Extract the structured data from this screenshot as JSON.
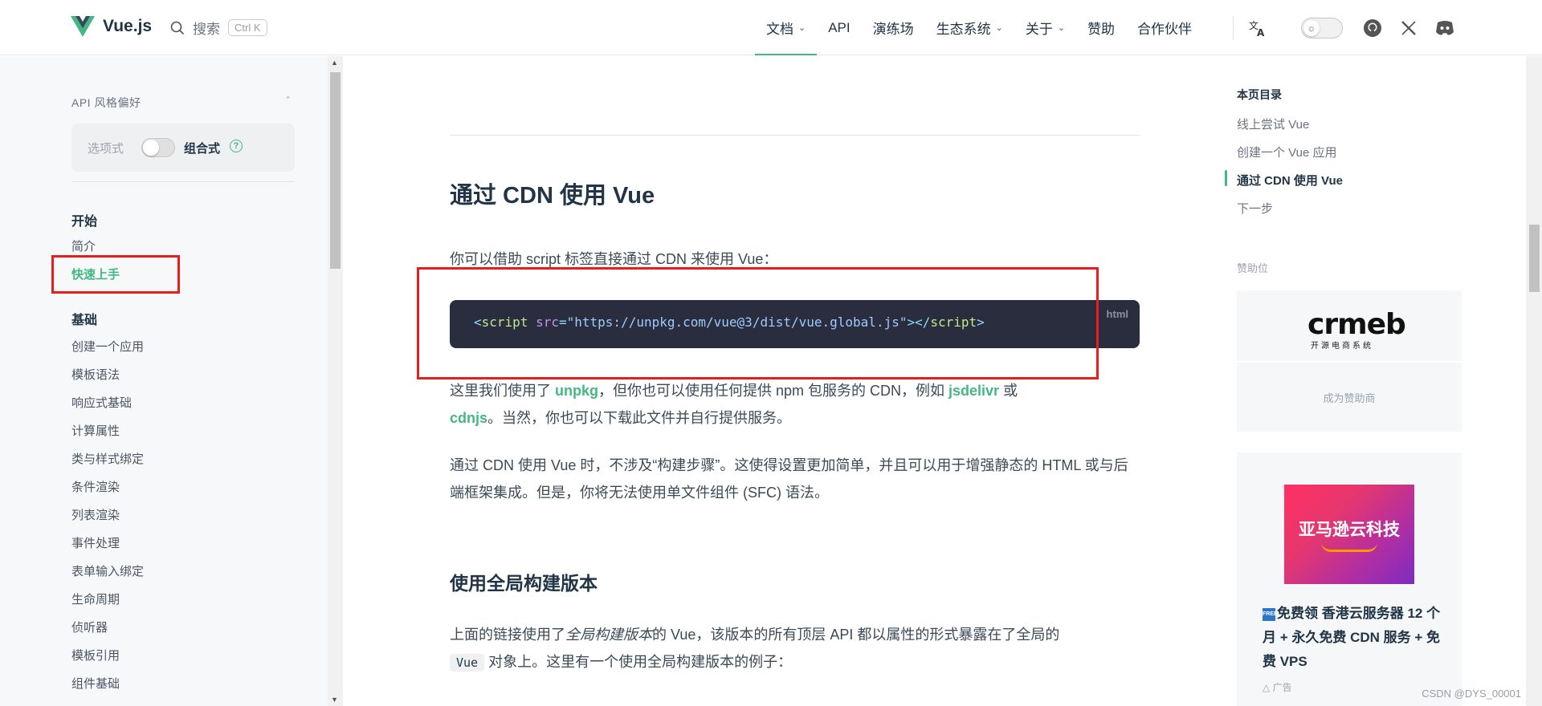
{
  "header": {
    "logo_text": "Vue.js",
    "search_label": "搜索",
    "search_shortcut": "Ctrl K",
    "nav": [
      {
        "label": "文档",
        "has_dropdown": true,
        "active": true
      },
      {
        "label": "API",
        "has_dropdown": false
      },
      {
        "label": "演练场",
        "has_dropdown": false
      },
      {
        "label": "生态系统",
        "has_dropdown": true
      },
      {
        "label": "关于",
        "has_dropdown": true
      },
      {
        "label": "赞助",
        "has_dropdown": false
      },
      {
        "label": "合作伙伴",
        "has_dropdown": false
      }
    ],
    "icons": [
      "translate-icon",
      "theme-toggle",
      "github-icon",
      "x-icon",
      "discord-icon"
    ],
    "brand_color": "#42b883"
  },
  "sidebar": {
    "pref_title": "API 风格偏好",
    "pref_option_1": "选项式",
    "pref_option_2": "组合式",
    "help_glyph": "?",
    "groups": [
      {
        "title": "开始",
        "items": [
          "简介",
          "快速上手"
        ]
      },
      {
        "title": "基础",
        "items": [
          "创建一个应用",
          "模板语法",
          "响应式基础",
          "计算属性",
          "类与样式绑定",
          "条件渲染",
          "列表渲染",
          "事件处理",
          "表单输入绑定",
          "生命周期",
          "侦听器",
          "模板引用",
          "组件基础"
        ]
      }
    ],
    "active_item": "快速上手"
  },
  "main": {
    "heading": "通过 CDN 使用 Vue",
    "intro": "你可以借助 script 标签直接通过 CDN 来使用 Vue：",
    "code": {
      "lang": "html",
      "open_lt": "<",
      "tag": "script",
      "attr": "src",
      "eq": "=",
      "value": "\"https://unpkg.com/vue@3/dist/vue.global.js\"",
      "mid": "></",
      "end_tag": "script",
      "close_gt": ">"
    },
    "para1_a": "这里我们使用了 ",
    "para1_link1": "unpkg",
    "para1_b": "，但你也可以使用任何提供 npm 包服务的 CDN，例如 ",
    "para1_link2": "jsdelivr",
    "para1_c": " 或",
    "para1_link3": "cdnjs",
    "para1_d": "。当然，你也可以下载此文件并自行提供服务。",
    "para2": "通过 CDN 使用 Vue 时，不涉及“构建步骤”。这使得设置更加简单，并且可以用于增强静态的 HTML 或与后端框架集成。但是，你将无法使用单文件组件 (SFC) 语法。",
    "subheading": "使用全局构建版本",
    "para3_a": "上面的链接使用了",
    "para3_em": "全局构建版本",
    "para3_b": "的 Vue，该版本的所有顶层 API 都以属性的形式暴露在了全局的",
    "para3_code": "Vue",
    "para3_c": " 对象上。这里有一个使用全局构建版本的例子："
  },
  "toc": {
    "title": "本页目录",
    "items": [
      "线上尝试 Vue",
      "创建一个 Vue 应用",
      "通过 CDN 使用 Vue",
      "下一步"
    ],
    "active_index": 2
  },
  "sponsor": {
    "title": "赞助位",
    "logo_text": "crmeb",
    "logo_sub": "开源电商系统",
    "cta": "成为赞助商"
  },
  "ad": {
    "image_text": "亚马逊云科技",
    "badge": "FREE",
    "text": "免费领 香港云服务器 12 个月 + 永久免费 CDN 服务 + 免费 VPS",
    "label": "广告"
  },
  "watermark": "CSDN @DYS_00001"
}
